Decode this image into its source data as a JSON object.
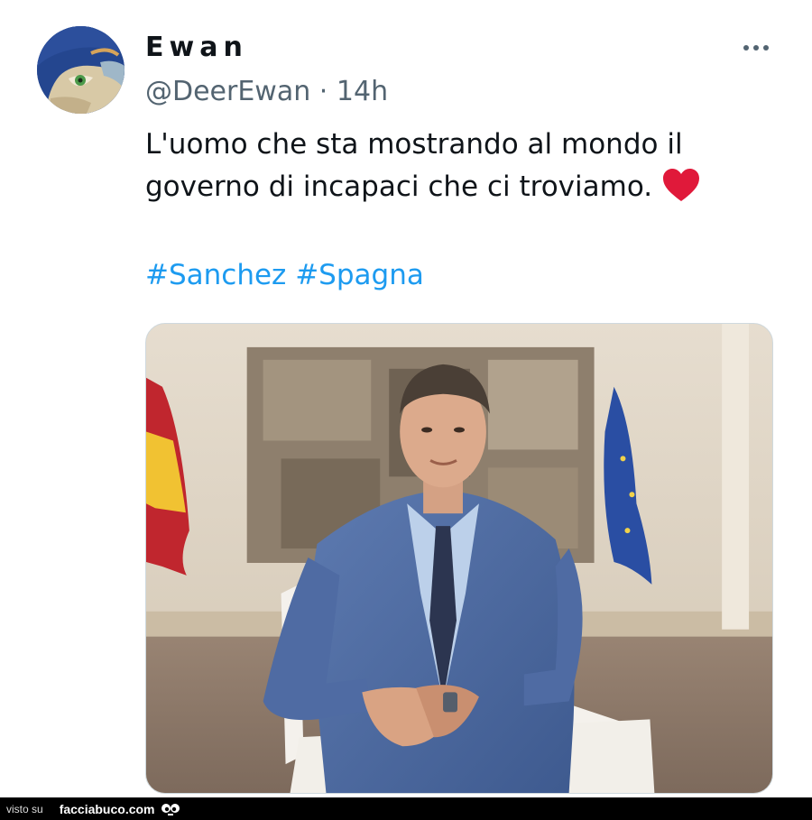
{
  "tweet": {
    "display_name": "Ewan",
    "handle": "@DeerEwan",
    "separator": "·",
    "time": "14h",
    "text_lines": [
      "L'uomo che sta mostrando al mondo il",
      "governo di incapaci che ci troviamo."
    ],
    "emoji": "red-heart",
    "hashtags": [
      "#Sanchez",
      "#Spagna"
    ],
    "more_icon": "ellipsis-icon",
    "media_icon": "photo"
  },
  "footer": {
    "prefix": "visto su",
    "site": "facciabuco.com",
    "logo_icon": "eyes-icon"
  },
  "colors": {
    "text": "#0f1419",
    "secondary": "#536471",
    "link": "#1d9bf0",
    "heart": "#e0193a",
    "footer_bg": "#000000"
  }
}
